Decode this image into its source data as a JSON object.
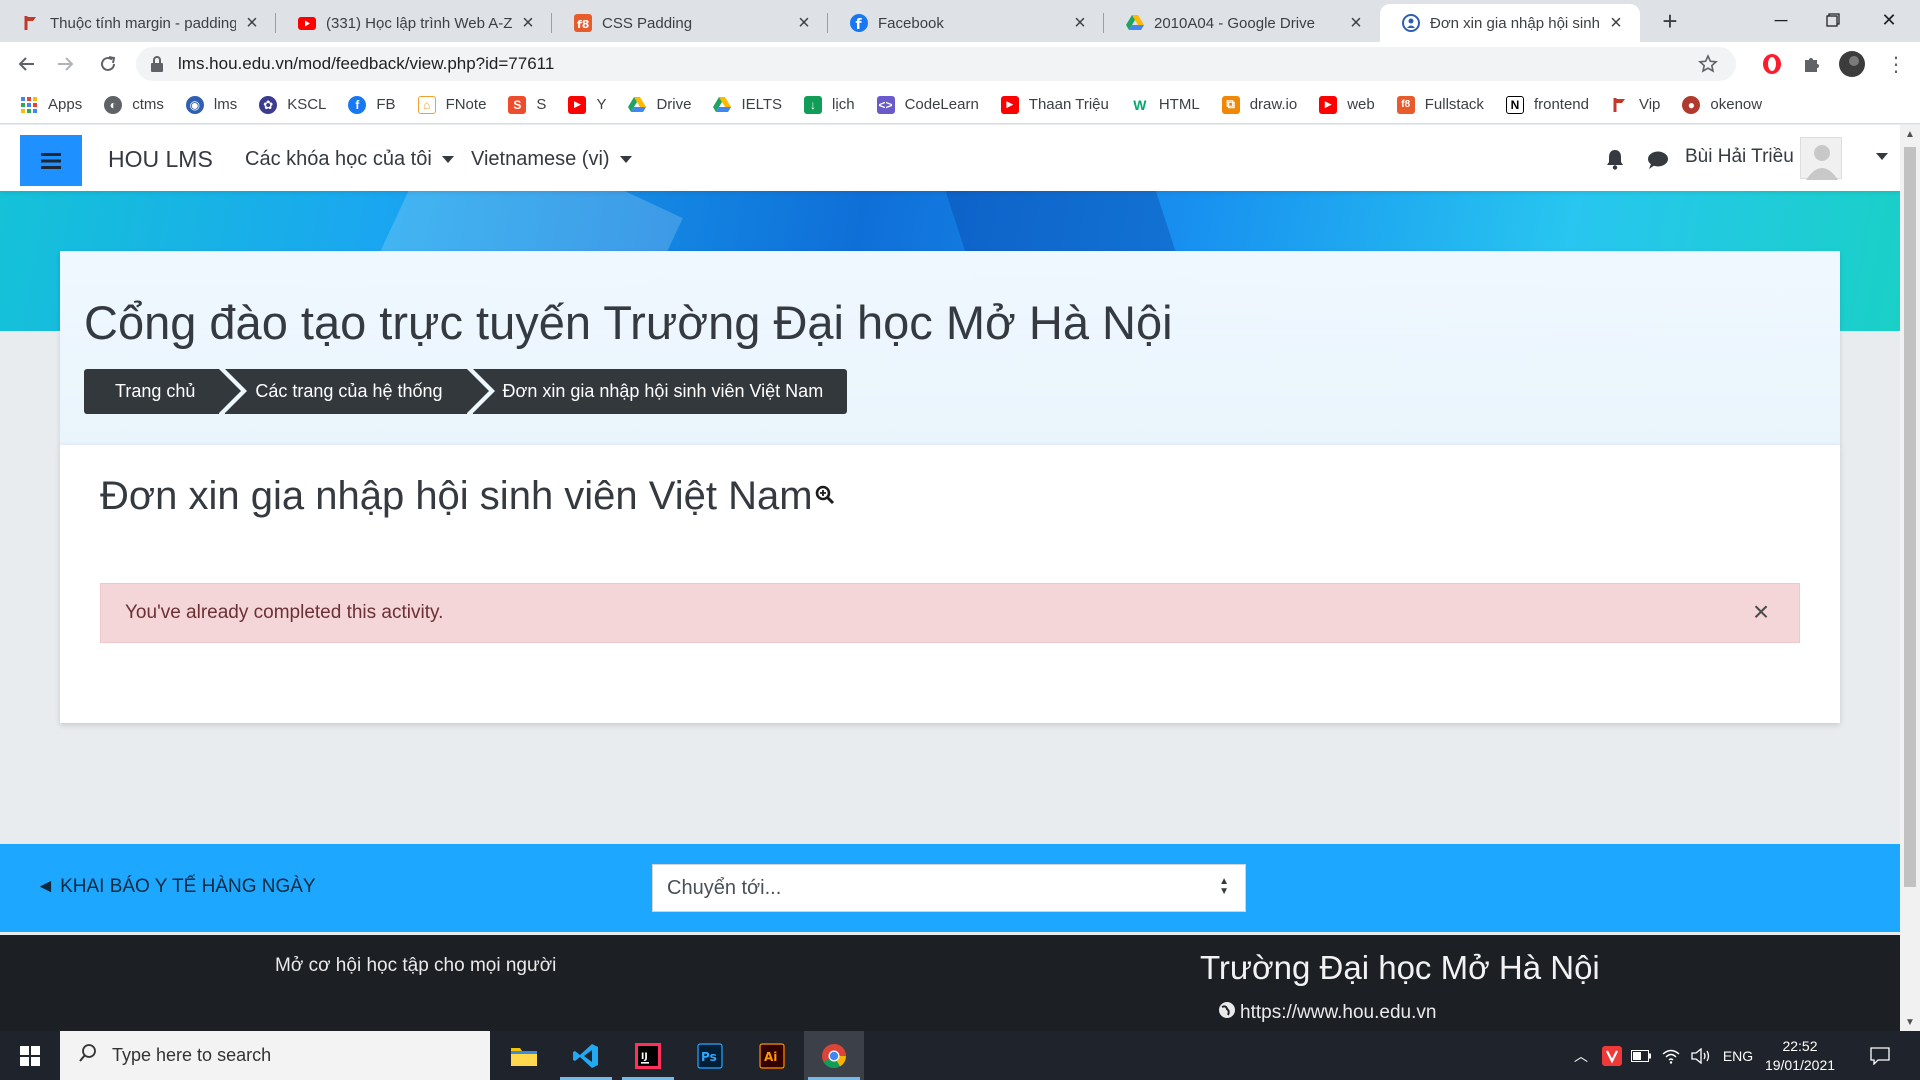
{
  "browser": {
    "tabs": [
      {
        "title": "Thuộc tính margin - padding",
        "icon_color": "#c0392b"
      },
      {
        "title": "(331) Học lập trình Web A-Z",
        "icon_color": "#ff0000"
      },
      {
        "title": "CSS Padding",
        "icon_color": "#e85b2c"
      },
      {
        "title": "Facebook",
        "icon_color": "#1877f2"
      },
      {
        "title": "2010A04 - Google Drive",
        "icon_color": "#1fa463"
      },
      {
        "title": "Đơn xin gia nhập hội sinh viê",
        "icon_color": "#2f5fb3"
      }
    ],
    "address": "lms.hou.edu.vn/mod/feedback/view.php?id=77611",
    "bookmarks": [
      {
        "label": "Apps",
        "icon": "apps-grid-icon",
        "color": "#4285f4"
      },
      {
        "label": "ctms",
        "icon": "globe-icon",
        "color": "#5f6368"
      },
      {
        "label": "lms",
        "icon": "hou-logo-icon",
        "color": "#2f5fb3"
      },
      {
        "label": "KSCL",
        "icon": "hou-seal-icon",
        "color": "#3b3b8f"
      },
      {
        "label": "FB",
        "icon": "facebook-icon",
        "color": "#1877f2"
      },
      {
        "label": "FNote",
        "icon": "house-icon",
        "color": "#f0a030"
      },
      {
        "label": "S",
        "icon": "shopee-icon",
        "color": "#ee4d2d"
      },
      {
        "label": "Y",
        "icon": "youtube-icon",
        "color": "#ff0000"
      },
      {
        "label": "Drive",
        "icon": "drive-icon",
        "color": "#1fa463"
      },
      {
        "label": "IELTS",
        "icon": "drive-icon",
        "color": "#1fa463"
      },
      {
        "label": "lịch",
        "icon": "calendar-icon",
        "color": "#0f9d58"
      },
      {
        "label": "CodeLearn",
        "icon": "codelearn-icon",
        "color": "#6a5acd"
      },
      {
        "label": "Thaan Triệu",
        "icon": "youtube-icon",
        "color": "#ff0000"
      },
      {
        "label": "HTML",
        "icon": "w3schools-icon",
        "color": "#04aa6d"
      },
      {
        "label": "draw.io",
        "icon": "drawio-icon",
        "color": "#f08705"
      },
      {
        "label": "web",
        "icon": "youtube-icon",
        "color": "#ff0000"
      },
      {
        "label": "Fullstack",
        "icon": "f8-icon",
        "color": "#e85b2c"
      },
      {
        "label": "frontend",
        "icon": "notion-icon",
        "color": "#000000"
      },
      {
        "label": "Vip",
        "icon": "flag-icon",
        "color": "#c0392b"
      },
      {
        "label": "okenow",
        "icon": "okenow-icon",
        "color": "#b03a2e"
      }
    ]
  },
  "lms": {
    "brand": "HOU LMS",
    "nav_courses": "Các khóa học của tôi",
    "nav_language": "Vietnamese (vi)",
    "user_name": "Bùi Hải Triều",
    "accent": "#1e90ff"
  },
  "header": {
    "site_title": "Cổng đào tạo trực tuyến Trường Đại học Mở Hà Nội",
    "breadcrumb": [
      "Trang chủ",
      "Các trang của hệ thống",
      "Đơn xin gia nhập hội sinh viên Việt Nam"
    ]
  },
  "main": {
    "heading": "Đơn xin gia nhập hội sinh viên Việt Nam",
    "alert": "You've already completed this activity.",
    "alert_close": "×"
  },
  "activity_nav": {
    "prev_link": "◄ KHAI BÁO Y TẾ HÀNG NGÀY",
    "jump_placeholder": "Chuyển tới..."
  },
  "footer": {
    "slogan": "Mở cơ hội học tập cho mọi người",
    "title": "Trường Đại học Mở Hà Nội",
    "url": "https://www.hou.edu.vn"
  },
  "taskbar": {
    "search_placeholder": "Type here to search",
    "language": "ENG",
    "time": "22:52",
    "date": "19/01/2021"
  }
}
